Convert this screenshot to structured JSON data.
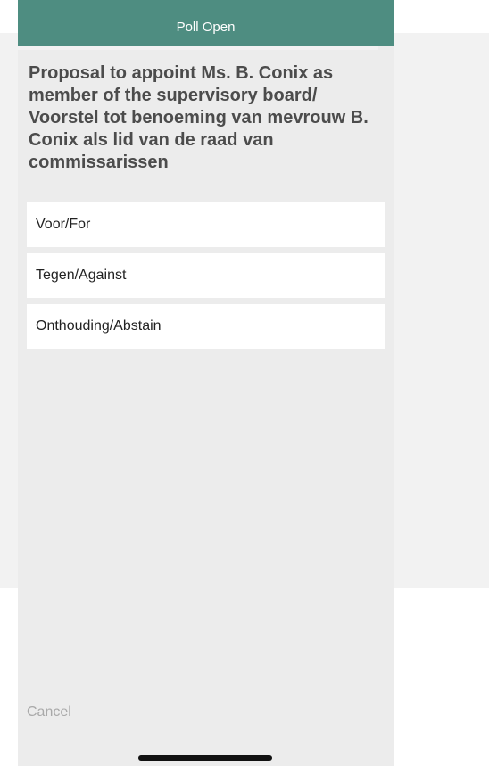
{
  "header": {
    "title": "Poll Open"
  },
  "poll": {
    "question": "Proposal to appoint Ms. B. Conix as member of the supervisory board/  Voorstel tot benoeming van mevrouw B. Conix als lid van de raad van commissarissen",
    "options": [
      {
        "label": "Voor/For"
      },
      {
        "label": "Tegen/Against"
      },
      {
        "label": "Onthouding/Abstain"
      }
    ]
  },
  "footer": {
    "cancel_label": "Cancel"
  },
  "colors": {
    "header": "#4e8d81",
    "sheet": "#ececec",
    "question_text": "#4c4c4c",
    "cancel_text": "#a9a9a9"
  }
}
